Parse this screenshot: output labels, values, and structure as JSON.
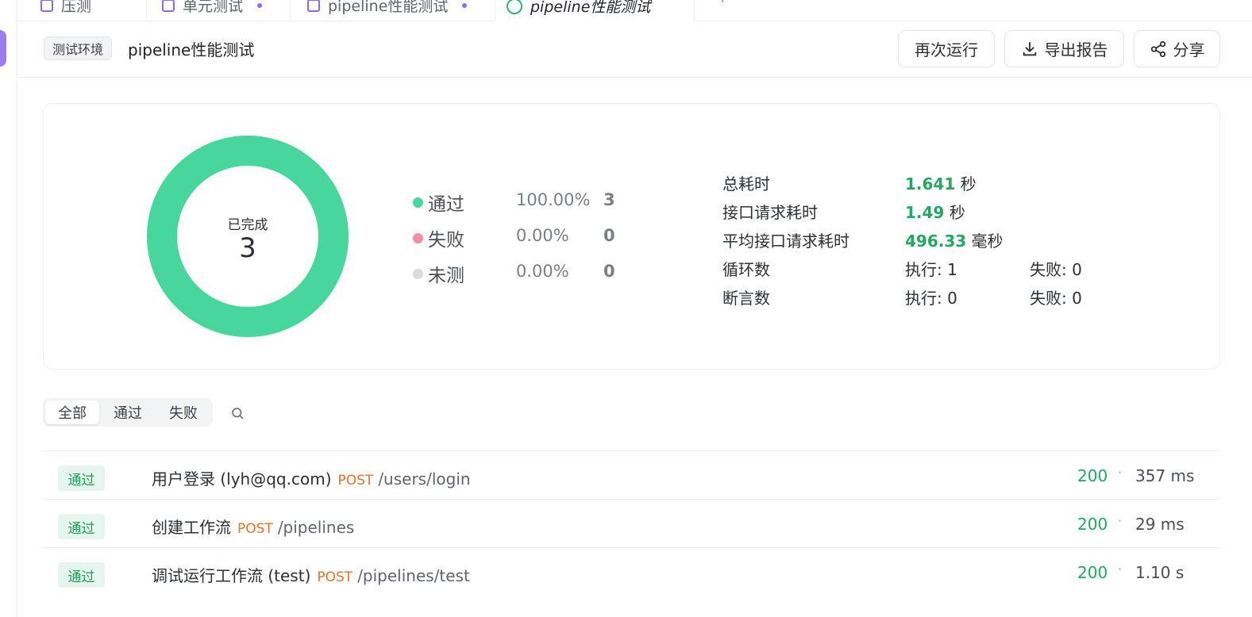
{
  "tabs": [
    {
      "label": "压测"
    },
    {
      "label": "单元测试"
    },
    {
      "label": "pipeline性能测试"
    },
    {
      "label": "pipeline性能测试"
    }
  ],
  "tab_add_label": "+",
  "header": {
    "env_badge": "测试环境",
    "title": "pipeline性能测试",
    "rerun_label": "再次运行",
    "export_label": "导出报告",
    "share_label": "分享"
  },
  "summary": {
    "donut_label": "已完成",
    "donut_count": "3",
    "legend": [
      {
        "name": "通过",
        "pct": "100.00%",
        "count": "3",
        "color": "#47d69c"
      },
      {
        "name": "失败",
        "pct": "0.00%",
        "count": "0",
        "color": "#f58ea3"
      },
      {
        "name": "未测",
        "pct": "0.00%",
        "count": "0",
        "color": "#d9dbde"
      }
    ],
    "stats": {
      "total_time_label": "总耗时",
      "total_time_value": "1.641",
      "total_time_unit": "秒",
      "req_time_label": "接口请求耗时",
      "req_time_value": "1.49",
      "req_time_unit": "秒",
      "avg_time_label": "平均接口请求耗时",
      "avg_time_value": "496.33",
      "avg_time_unit": "毫秒",
      "loops_label": "循环数",
      "loops_exec": "执行: 1",
      "loops_fail": "失败: 0",
      "asserts_label": "断言数",
      "asserts_exec": "执行: 0",
      "asserts_fail": "失败: 0"
    }
  },
  "filters": [
    "全部",
    "通过",
    "失败"
  ],
  "requests": [
    {
      "badge": "通过",
      "name": "用户登录 (lyh@qq.com)",
      "method": "POST",
      "path": "/users/login",
      "status": "200",
      "sep": "·",
      "duration": "357 ms"
    },
    {
      "badge": "通过",
      "name": "创建工作流",
      "method": "POST",
      "path": "/pipelines",
      "status": "200",
      "sep": "·",
      "duration": "29 ms"
    },
    {
      "badge": "通过",
      "name": "调试运行工作流 (test)",
      "method": "POST",
      "path": "/pipelines/test",
      "status": "200",
      "sep": "·",
      "duration": "1.10 s"
    }
  ],
  "colors": {
    "accent": "#8a6cf0",
    "success": "#22a861",
    "method": "#e8702a"
  }
}
